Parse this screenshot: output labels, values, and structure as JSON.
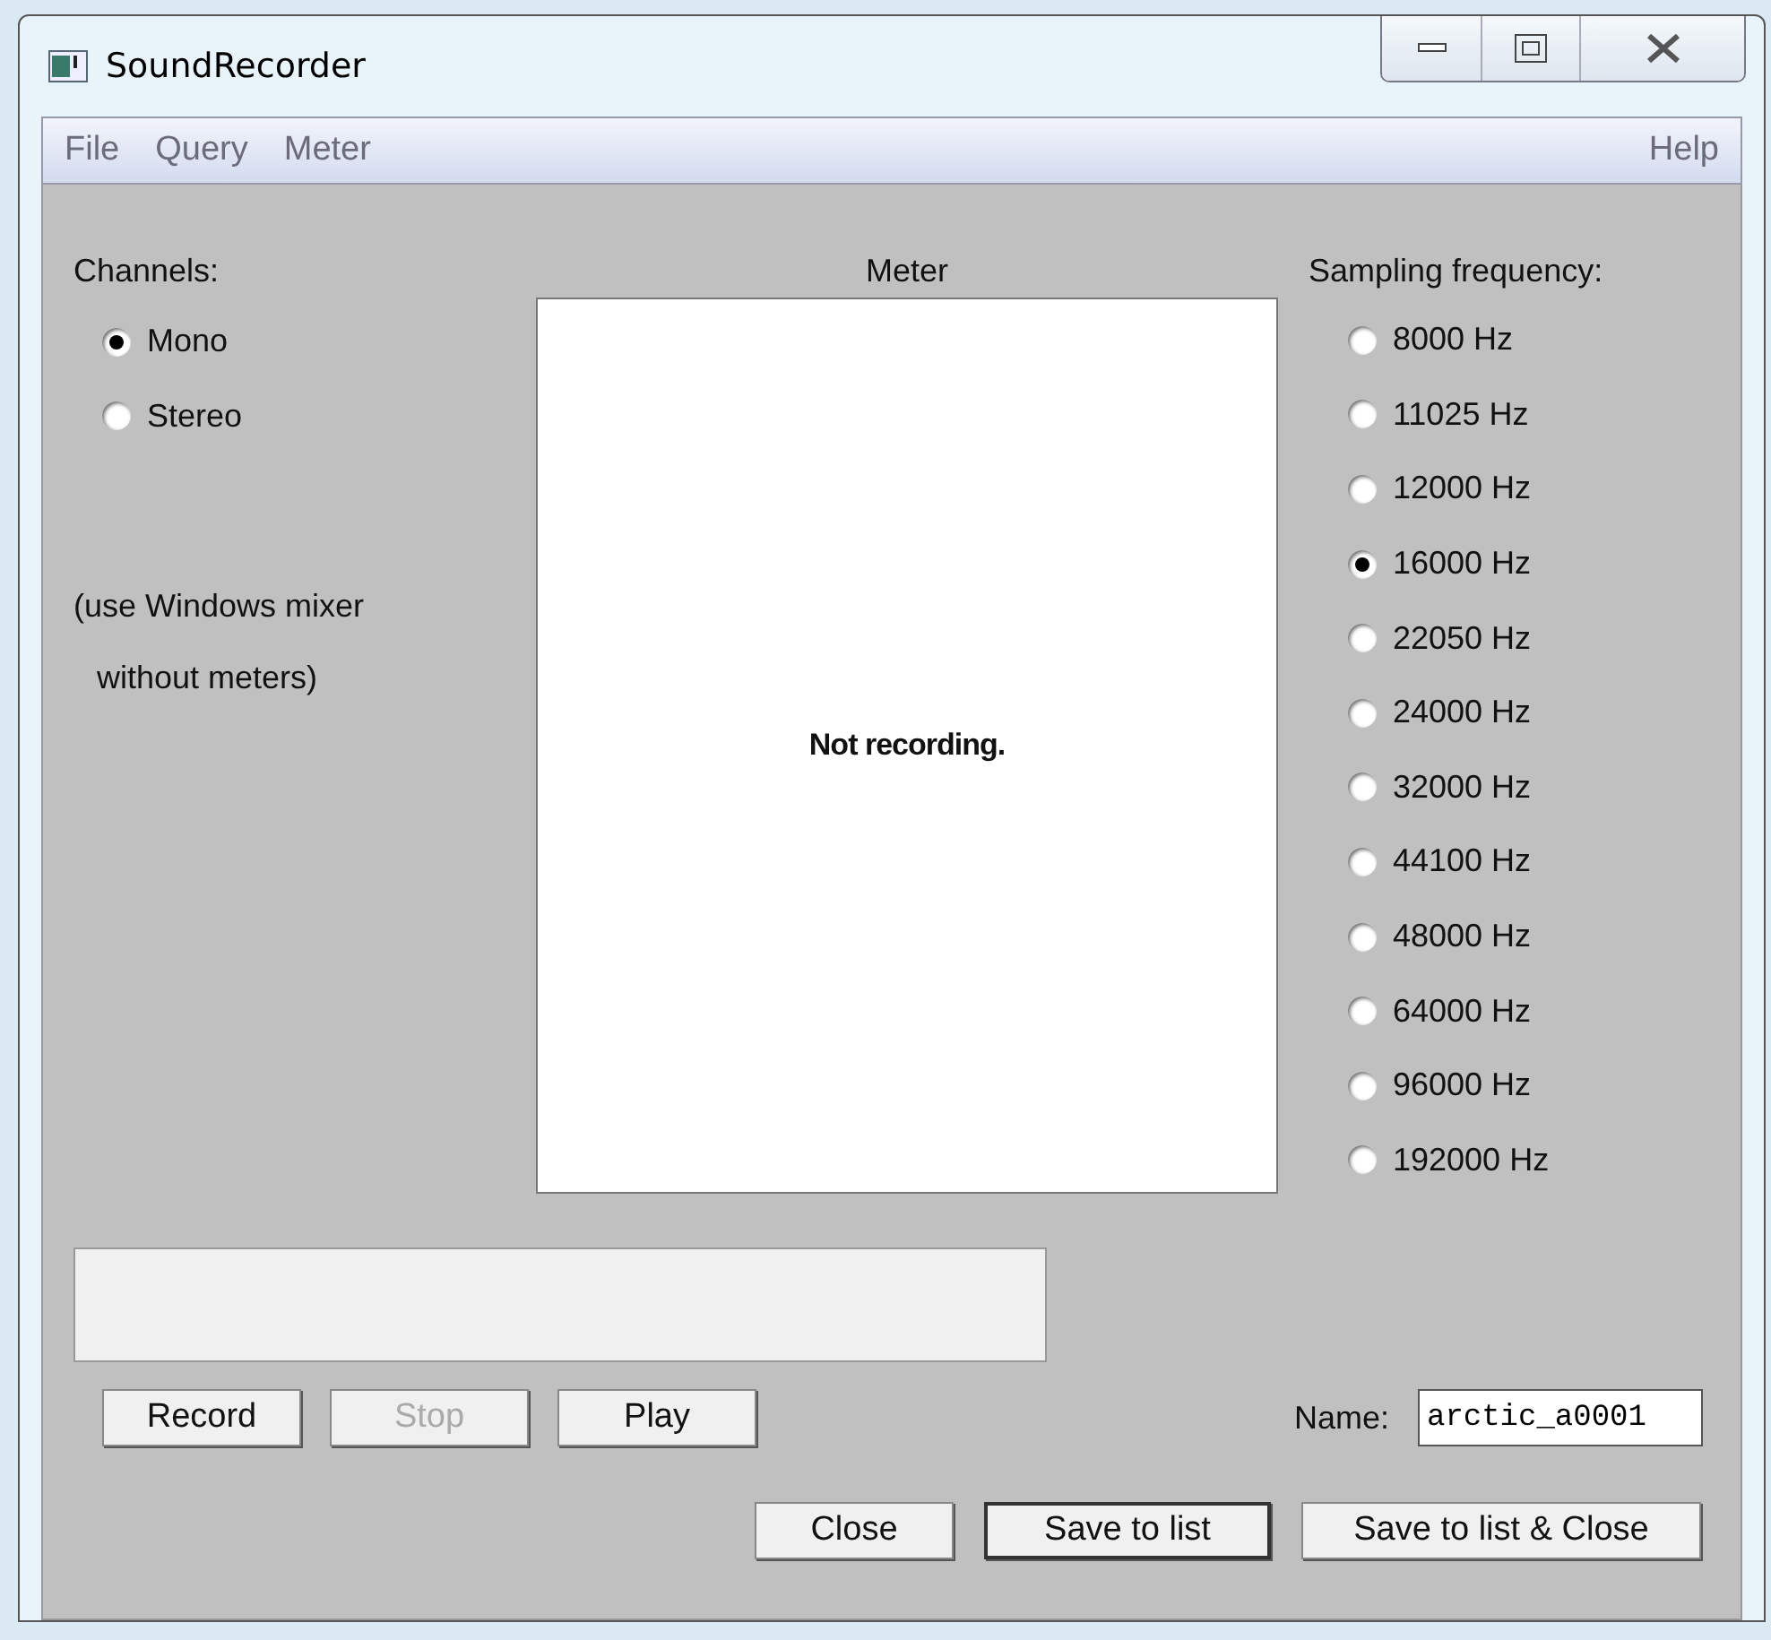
{
  "window": {
    "title": "SoundRecorder"
  },
  "menu": {
    "items": [
      "File",
      "Query",
      "Meter"
    ],
    "help": "Help"
  },
  "channels": {
    "label": "Channels:",
    "options": [
      {
        "label": "Mono",
        "selected": true
      },
      {
        "label": "Stereo",
        "selected": false
      }
    ],
    "note": [
      "(use Windows mixer",
      "without meters)"
    ]
  },
  "meter": {
    "title": "Meter",
    "message": "Not recording."
  },
  "sampling": {
    "label": "Sampling frequency:",
    "options": [
      {
        "label": "8000 Hz",
        "selected": false
      },
      {
        "label": "11025 Hz",
        "selected": false
      },
      {
        "label": "12000 Hz",
        "selected": false
      },
      {
        "label": "16000 Hz",
        "selected": true
      },
      {
        "label": "22050 Hz",
        "selected": false
      },
      {
        "label": "24000 Hz",
        "selected": false
      },
      {
        "label": "32000 Hz",
        "selected": false
      },
      {
        "label": "44100 Hz",
        "selected": false
      },
      {
        "label": "48000 Hz",
        "selected": false
      },
      {
        "label": "64000 Hz",
        "selected": false
      },
      {
        "label": "96000 Hz",
        "selected": false
      },
      {
        "label": "192000 Hz",
        "selected": false
      }
    ]
  },
  "transport": [
    {
      "label": "Record",
      "disabled": false
    },
    {
      "label": "Stop",
      "disabled": true
    },
    {
      "label": "Play",
      "disabled": false
    }
  ],
  "name": {
    "label": "Name:",
    "value": "arctic_a0001"
  },
  "actions": [
    {
      "label": "Close",
      "default": false
    },
    {
      "label": "Save to list",
      "default": true
    },
    {
      "label": "Save to list & Close",
      "default": false
    }
  ]
}
